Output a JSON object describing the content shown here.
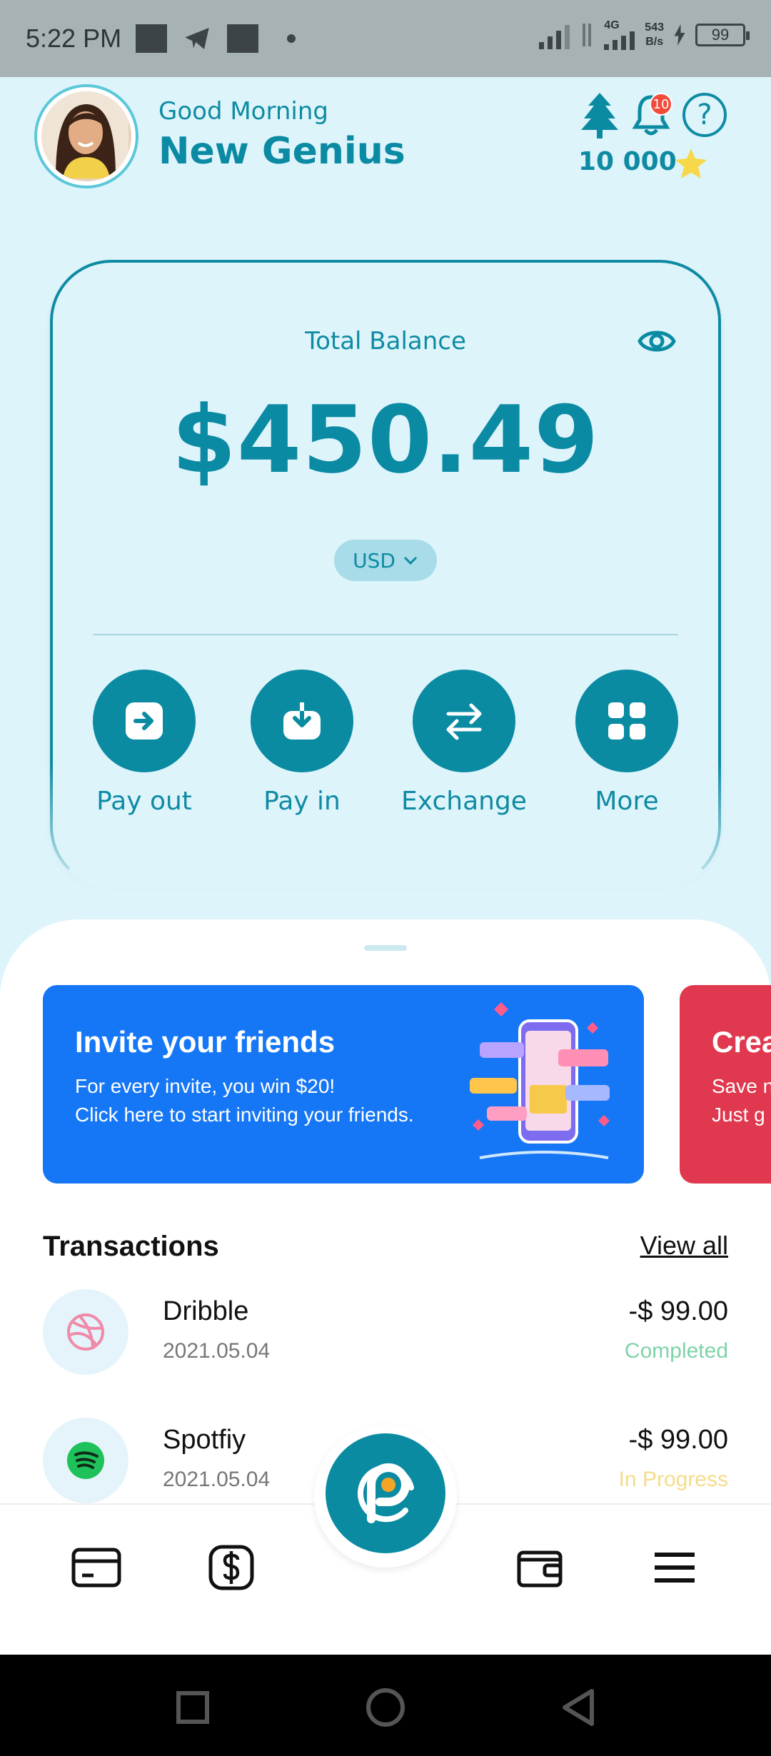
{
  "status_bar": {
    "time": "5:22 PM",
    "net_type": "4G",
    "speed_value": "543",
    "speed_unit": "B/s",
    "battery": "99"
  },
  "header": {
    "greeting": "Good Morning",
    "username": "New Genius",
    "notification_count": "10",
    "help_glyph": "?",
    "points": "10 000"
  },
  "balance": {
    "label": "Total Balance",
    "amount": "$450.49",
    "currency": "USD"
  },
  "actions": [
    {
      "label": "Pay out",
      "icon": "arrow-right-square-icon"
    },
    {
      "label": "Pay in",
      "icon": "download-tray-icon"
    },
    {
      "label": "Exchange",
      "icon": "swap-arrows-icon"
    },
    {
      "label": "More",
      "icon": "grid-icon"
    }
  ],
  "promos": [
    {
      "title": "Invite your friends",
      "line1": "For every invite, you win $20!",
      "line2": "Click here to start inviting your friends.",
      "color": "#1677f6"
    },
    {
      "title": "Crea",
      "line1": "Save n",
      "line2": "Just g",
      "color": "#e0384e"
    }
  ],
  "transactions": {
    "title": "Transactions",
    "view_all": "View all",
    "items": [
      {
        "name": "Dribble",
        "date": "2021.05.04",
        "amount": "-$ 99.00",
        "status": "Completed",
        "status_color": "#7ed3a8",
        "icon": "dribbble-icon"
      },
      {
        "name": "Spotfiy",
        "date": "2021.05.04",
        "amount": "-$ 99.00",
        "status": "In Progress",
        "status_color": "#f5dc8a",
        "icon": "spotify-icon"
      }
    ]
  },
  "colors": {
    "primary": "#0a8ba2",
    "background": "#def4fb",
    "accent_star": "#f7d84a",
    "badge": "#f14c3a"
  }
}
